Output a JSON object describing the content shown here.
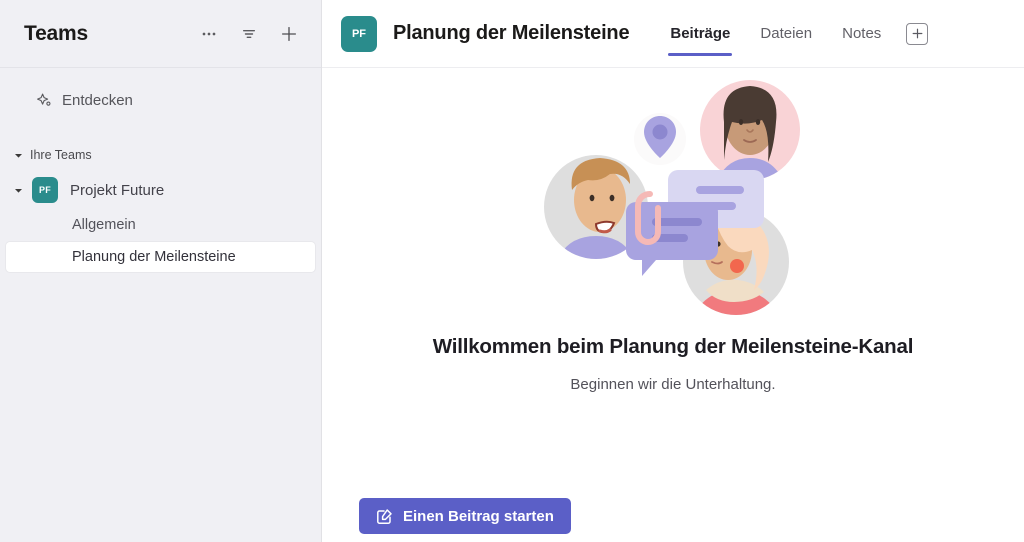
{
  "sidebar": {
    "title": "Teams",
    "actions": [
      {
        "name": "more-options-icon",
        "label": "..."
      },
      {
        "name": "filter-icon",
        "label": "Filter"
      },
      {
        "name": "add-team-icon",
        "label": "+"
      }
    ],
    "discover": {
      "label": "Entdecken",
      "icon": "sparkle-icon"
    },
    "group": {
      "label": "Ihre Teams",
      "expanded": true
    },
    "team": {
      "name": "Projekt Future",
      "initials": "PF",
      "avatar_color": "#2A8C8C",
      "expanded": true
    },
    "channels": [
      {
        "label": "Allgemein",
        "selected": false
      },
      {
        "label": "Planung der Meilensteine",
        "selected": true
      }
    ]
  },
  "main": {
    "channel": {
      "initials": "PF",
      "title": "Planung der Meilensteine",
      "avatar_color": "#2A8C8C"
    },
    "tabs": [
      {
        "label": "Beiträge",
        "active": true
      },
      {
        "label": "Dateien",
        "active": false
      },
      {
        "label": "Notes",
        "active": false
      }
    ],
    "add_tab_label": "+",
    "welcome_heading": "Willkommen beim Planung der Meilensteine-Kanal",
    "welcome_subtitle": "Beginnen wir die Unterhaltung.",
    "start_post_button": "Einen Beitrag starten",
    "accent_color": "#5B5FC7"
  }
}
